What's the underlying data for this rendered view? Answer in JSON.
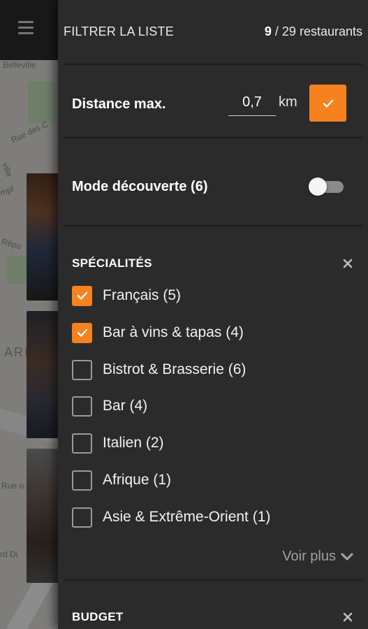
{
  "background": {
    "map_labels": [
      "Belleville",
      "Rue des C",
      "ville",
      "Répu",
      "ARI",
      "Rue o",
      "mpf",
      "rd Di"
    ]
  },
  "header": {
    "title": "FILTRER LA LISTE",
    "count_shown": "9",
    "count_total": "/ 29 restaurants"
  },
  "distance": {
    "label": "Distance max.",
    "value": "0,7",
    "unit": "km"
  },
  "discovery": {
    "label": "Mode découverte (6)",
    "enabled": false
  },
  "specialties": {
    "title": "SPÉCIALITÉS",
    "items": [
      {
        "label": "Français (5)",
        "checked": true
      },
      {
        "label": "Bar à vins & tapas (4)",
        "checked": true
      },
      {
        "label": "Bistrot & Brasserie (6)",
        "checked": false
      },
      {
        "label": "Bar (4)",
        "checked": false
      },
      {
        "label": "Italien (2)",
        "checked": false
      },
      {
        "label": "Afrique (1)",
        "checked": false
      },
      {
        "label": "Asie & Extrême-Orient (1)",
        "checked": false
      }
    ],
    "see_more": "Voir plus"
  },
  "budget": {
    "title": "BUDGET"
  },
  "colors": {
    "accent": "#f5821f",
    "drawer_bg": "#2b2b2b"
  }
}
